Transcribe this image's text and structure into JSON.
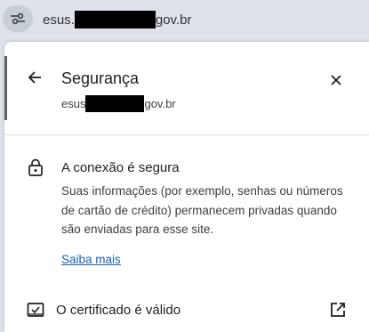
{
  "addressbar": {
    "url_prefix": "esus.",
    "url_suffix": "gov.br",
    "site_settings_icon": "tune-icon"
  },
  "panel": {
    "title": "Segurança",
    "subtitle_prefix": "esus",
    "subtitle_suffix": "gov.br",
    "back_icon": "arrow-back-icon",
    "close_icon": "close-icon"
  },
  "security": {
    "heading": "A conexão é segura",
    "description": "Suas informações (por exemplo, senhas ou números de cartão de crédito) permanecem privadas quando são enviadas para esse site.",
    "learn_more": "Saiba mais",
    "icon": "lock-icon"
  },
  "certificate": {
    "label": "O certificado é válido",
    "icon": "certificate-icon",
    "open_icon": "open-in-new-icon"
  },
  "colors": {
    "link": "#1a5fb4",
    "toolbar": "#dfe3e9"
  }
}
